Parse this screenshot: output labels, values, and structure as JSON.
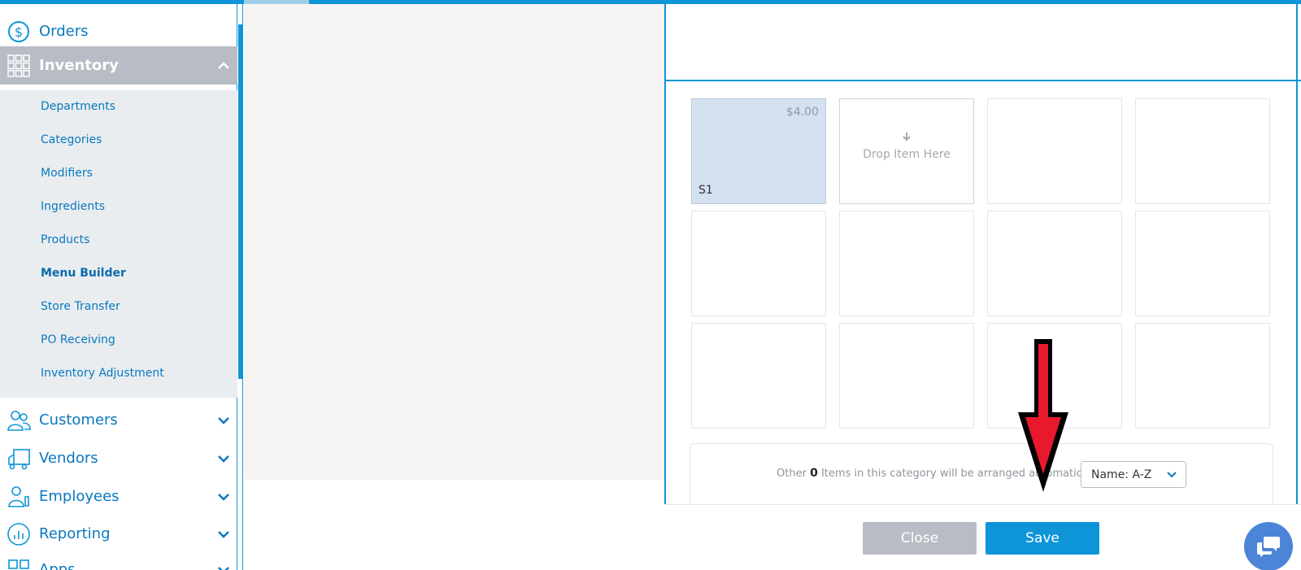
{
  "sidebar": {
    "items": [
      {
        "label": "Orders",
        "icon": "dollar-refresh-icon"
      },
      {
        "label": "Inventory",
        "icon": "grid-icon"
      },
      {
        "label": "Customers",
        "icon": "users-icon"
      },
      {
        "label": "Vendors",
        "icon": "truck-icon"
      },
      {
        "label": "Employees",
        "icon": "employee-icon"
      },
      {
        "label": "Reporting",
        "icon": "chart-icon"
      },
      {
        "label": "Apps",
        "icon": "apps-icon"
      }
    ],
    "submenu": [
      "Departments",
      "Categories",
      "Modifiers",
      "Ingredients",
      "Products",
      "Menu Builder",
      "Store Transfer",
      "PO Receiving",
      "Inventory Adjustment"
    ],
    "current_submenu": "Menu Builder"
  },
  "grid": {
    "filled_cell": {
      "price": "$4.00",
      "name": "S1"
    },
    "drop_text": "Drop Item Here"
  },
  "arrange": {
    "prefix": "Other",
    "count": "0",
    "suffix": "Items in this category will be arranged automatically by",
    "sort_value": "Name: A-Z"
  },
  "footer": {
    "close_label": "Close",
    "save_label": "Save"
  },
  "colors": {
    "accent": "#0e95d8",
    "sidebar_active": "#b8bcc4",
    "annotation": "#e8192c"
  }
}
